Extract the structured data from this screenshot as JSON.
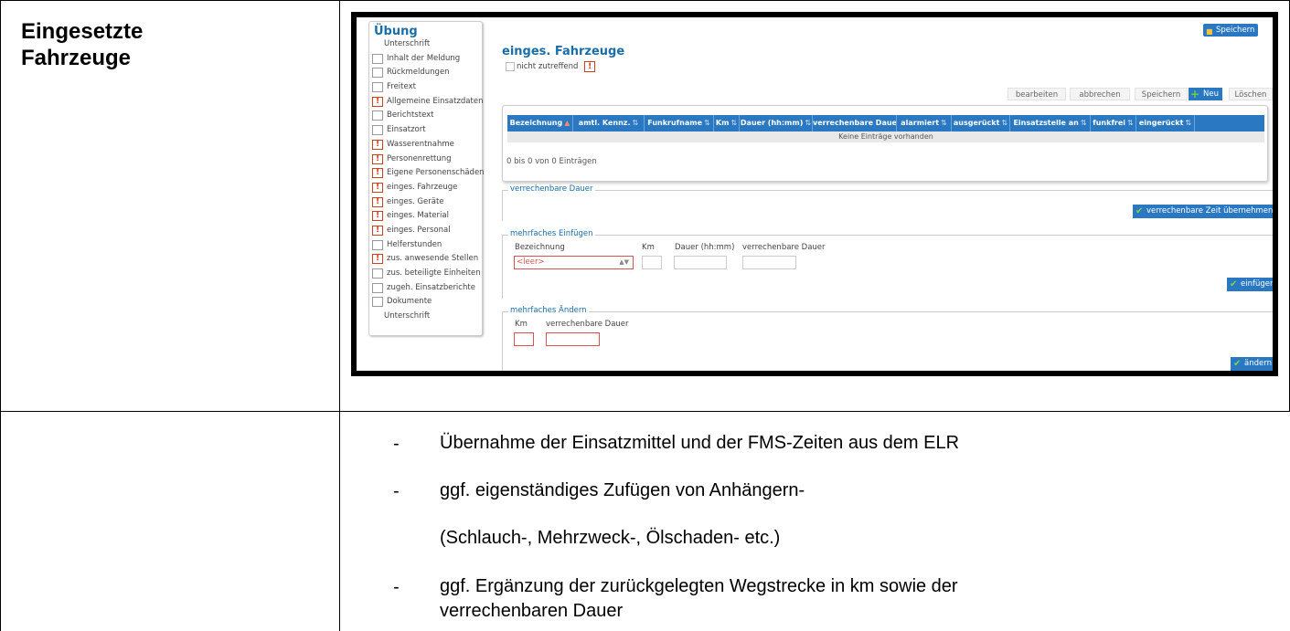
{
  "left_title": [
    "Eingesetzte",
    "Fahrzeuge"
  ],
  "app": {
    "sidebar": {
      "title": "Übung",
      "items": [
        {
          "label": "Unterschrift",
          "mark": "none"
        },
        {
          "label": "Inhalt der Meldung",
          "mark": "box"
        },
        {
          "label": "Rückmeldungen",
          "mark": "box"
        },
        {
          "label": "Freitext",
          "mark": "box"
        },
        {
          "label": "Allgemeine Einsatzdaten",
          "mark": "warn"
        },
        {
          "label": "Berichtstext",
          "mark": "box"
        },
        {
          "label": "Einsatzort",
          "mark": "box"
        },
        {
          "label": "Wasserentnahme",
          "mark": "warn"
        },
        {
          "label": "Personenrettung",
          "mark": "warn"
        },
        {
          "label": "Eigene Personenschäden",
          "mark": "warn"
        },
        {
          "label": "einges. Fahrzeuge",
          "mark": "warn"
        },
        {
          "label": "einges. Geräte",
          "mark": "warn"
        },
        {
          "label": "einges. Material",
          "mark": "warn"
        },
        {
          "label": "einges. Personal",
          "mark": "warn"
        },
        {
          "label": "Helferstunden",
          "mark": "box"
        },
        {
          "label": "zus. anwesende Stellen",
          "mark": "warn"
        },
        {
          "label": "zus. beteiligte Einheiten",
          "mark": "box"
        },
        {
          "label": "zugeh. Einsatzberichte",
          "mark": "box"
        },
        {
          "label": "Dokumente",
          "mark": "box"
        },
        {
          "label": "Unterschrift",
          "mark": "none"
        }
      ]
    },
    "save_top": "Speichern",
    "main_title": "einges. Fahrzeuge",
    "not_applicable": "nicht zutreffend",
    "toolbar": {
      "bearbeiten": "bearbeiten",
      "abbrechen": "abbrechen",
      "speichern": "Speichern",
      "neu": "Neu",
      "loeschen": "Löschen"
    },
    "grid": {
      "columns": [
        "Bezeichnung",
        "amtl. Kennz.",
        "Funkrufname",
        "Km",
        "Dauer (hh:mm)",
        "verrechenbare Dauer",
        "alarmiert",
        "ausgerückt",
        "Einsatzstelle an",
        "funkfrei",
        "eingerückt"
      ],
      "empty_text": "Keine Einträge vorhanden",
      "count_text": "0 bis 0 von 0 Einträgen"
    },
    "fs_dauer": {
      "legend": "verrechenbare Dauer",
      "button": "verrechenbare Zeit übernehmen"
    },
    "fs_einfuegen": {
      "legend": "mehrfaches Einfügen",
      "label_bez": "Bezeichnung",
      "label_km": "Km",
      "label_dauer": "Dauer (hh:mm)",
      "label_verr": "verrechenbare Dauer",
      "select_value": "<leer>",
      "button": "einfügen"
    },
    "fs_aendern": {
      "legend": "mehrfaches Ändern",
      "label_km": "Km",
      "label_verr": "verrechenbare Dauer",
      "button": "ändern"
    }
  },
  "bullets": [
    {
      "dash": "-",
      "lines": [
        "Übernahme der Einsatzmittel und der FMS-Zeiten aus dem ELR"
      ]
    },
    {
      "dash": "-",
      "lines": [
        "ggf. eigenständiges Zufügen von Anhängern-",
        "(Schlauch-, Mehrzweck-, Ölschaden- etc.)"
      ]
    },
    {
      "dash": "-",
      "lines": [
        "ggf. Ergänzung der zurückgelegten Wegstrecke in km sowie der",
        "verrechenbaren Dauer"
      ]
    }
  ]
}
